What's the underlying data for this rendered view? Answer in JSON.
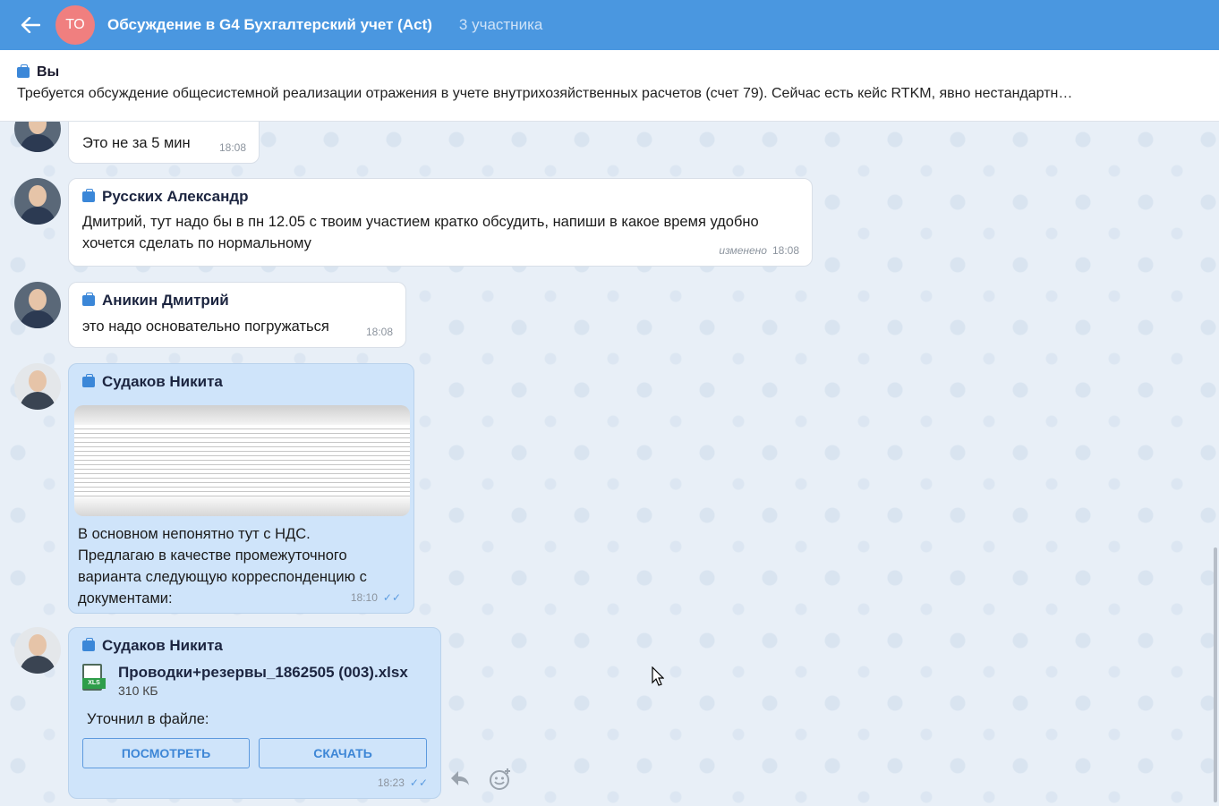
{
  "header": {
    "avatar_initials": "ТО",
    "title": "Обсуждение в G4 Бухгалтерский учет (Act)",
    "members": "3 участника"
  },
  "pinned": {
    "author": "Вы",
    "text": "Требуется обсуждение общесистемной реализации отражения в учете внутрихозяйственных расчетов (счет 79). Сейчас есть кейс RTKM, явно нестандартн…"
  },
  "messages": [
    {
      "text": "Это не за 5 мин",
      "time": "18:08"
    },
    {
      "author": "Русских Александр",
      "text_line1": "Дмитрий, тут надо бы в пн 12.05 с твоим участием кратко обсудить, напиши в какое время удобно",
      "text_line2": "хочется сделать по нормальному",
      "edited": "изменено",
      "time": "18:08"
    },
    {
      "author": "Аникин Дмитрий",
      "text": "это надо основательно погружаться",
      "time": "18:08"
    },
    {
      "author": "Судаков Никита",
      "text_lines": [
        "В основном непонятно тут с НДС.",
        "Предлагаю в качестве промежуточного",
        "варианта следующую корреспонденцию с",
        "документами:"
      ],
      "time": "18:10"
    },
    {
      "author": "Судаков Никита",
      "file_name": "Проводки+резервы_1862505 (003).xlsx",
      "file_size": "310 КБ",
      "file_ext": "XLS",
      "text": "Уточнил в файле:",
      "view_button": "ПОСМОТРЕТЬ",
      "download_button": "СКАЧАТЬ",
      "time": "18:23"
    }
  ],
  "colors": {
    "header_bg": "#4a97e0",
    "own_bubble": "#cfe4fa",
    "accent": "#3b87d8"
  }
}
